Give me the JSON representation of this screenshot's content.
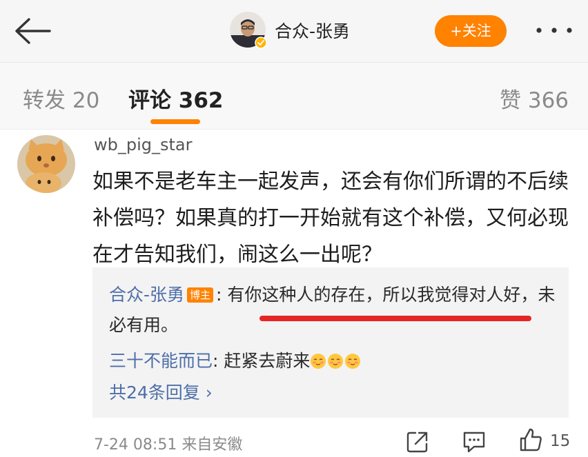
{
  "header": {
    "author_name": "合众-张勇",
    "follow_label": "+关注"
  },
  "tabs": {
    "repost": "转发 20",
    "comments": "评论 362",
    "likes": "赞 366"
  },
  "comment": {
    "username": "wb_pig_star",
    "text": "如果不是老车主一起发声，还会有你们所谓的不后续补偿吗？如果真的打一开始就有这个补偿，又何必现在才告知我们，闹这么一出呢？",
    "replies": [
      {
        "author": "合众-张勇",
        "badge": "博主",
        "text": ": 有你这种人的存在，所以我觉得对人好，未必有用。"
      },
      {
        "author": "三十不能而已",
        "text": ": 赶紧去蔚来"
      }
    ],
    "more_replies": "共24条回复 ›",
    "meta": "7-24 08:51 来自安徽",
    "like_count": "15"
  },
  "colors": {
    "accent": "#ff8200",
    "link": "#4e6ea8",
    "highlight": "#e52625"
  },
  "icons": [
    "back-arrow-icon",
    "verified-icon",
    "more-dots-icon",
    "share-icon",
    "comment-icon",
    "like-icon",
    "emoji-icon"
  ]
}
